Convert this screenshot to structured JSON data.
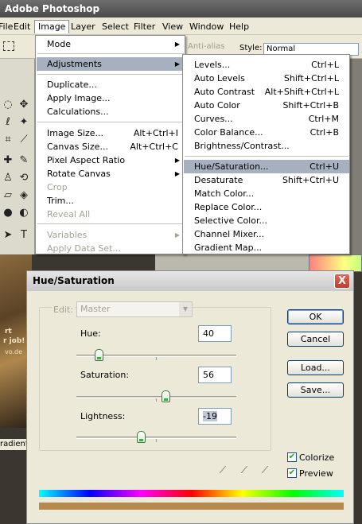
{
  "app": {
    "title": "Adobe Photoshop"
  },
  "menubar": {
    "items": [
      "File",
      "Edit",
      "Image",
      "Layer",
      "Select",
      "Filter",
      "View",
      "Window",
      "Help"
    ]
  },
  "options": {
    "antialias": "Anti-alias",
    "style_label": "Style:",
    "style_value": "Normal"
  },
  "image_menu": {
    "items": [
      {
        "label": "Mode",
        "submenu": true
      },
      {
        "label": "Adjustments",
        "submenu": true,
        "highlighted": true
      },
      {
        "label": "Duplicate..."
      },
      {
        "label": "Apply Image..."
      },
      {
        "label": "Calculations..."
      },
      {
        "label": "Image Size...",
        "shortcut": "Alt+Ctrl+I"
      },
      {
        "label": "Canvas Size...",
        "shortcut": "Alt+Ctrl+C"
      },
      {
        "label": "Pixel Aspect Ratio",
        "submenu": true
      },
      {
        "label": "Rotate Canvas",
        "submenu": true
      },
      {
        "label": "Crop",
        "disabled": true
      },
      {
        "label": "Trim..."
      },
      {
        "label": "Reveal All",
        "disabled": true
      },
      {
        "label": "Variables",
        "submenu": true,
        "disabled": true
      },
      {
        "label": "Apply Data Set...",
        "disabled": true
      }
    ]
  },
  "adjustments_menu": {
    "items": [
      {
        "label": "Levels...",
        "shortcut": "Ctrl+L"
      },
      {
        "label": "Auto Levels",
        "shortcut": "Shift+Ctrl+L"
      },
      {
        "label": "Auto Contrast",
        "shortcut": "Alt+Shift+Ctrl+L"
      },
      {
        "label": "Auto Color",
        "shortcut": "Shift+Ctrl+B"
      },
      {
        "label": "Curves...",
        "shortcut": "Ctrl+M"
      },
      {
        "label": "Color Balance...",
        "shortcut": "Ctrl+B"
      },
      {
        "label": "Brightness/Contrast..."
      },
      {
        "label": "Hue/Saturation...",
        "shortcut": "Ctrl+U",
        "highlighted": true
      },
      {
        "label": "Desaturate",
        "shortcut": "Shift+Ctrl+U"
      },
      {
        "label": "Match Color..."
      },
      {
        "label": "Replace Color..."
      },
      {
        "label": "Selective Color..."
      },
      {
        "label": "Channel Mixer..."
      },
      {
        "label": "Gradient Map..."
      }
    ]
  },
  "background": {
    "photo_text_1": "rt",
    "photo_text_2": "r job!",
    "photo_text_3": "vo.de",
    "gradient_label": "radient"
  },
  "dialog": {
    "title": "Hue/Saturation",
    "close": "X",
    "edit_label": "Edit:",
    "edit_value": "Master",
    "hue": {
      "label": "Hue:",
      "value": "40",
      "level": 0.14
    },
    "saturation": {
      "label": "Saturation:",
      "value": "56",
      "level": 0.56
    },
    "lightness": {
      "label": "Lightness:",
      "value": "-19",
      "level": 0.405
    },
    "buttons": {
      "ok": "OK",
      "cancel": "Cancel",
      "load": "Load...",
      "save": "Save..."
    },
    "colorize": {
      "label": "Colorize",
      "checked": true
    },
    "preview": {
      "label": "Preview",
      "checked": true
    },
    "tint_color": "#b58a4c"
  }
}
